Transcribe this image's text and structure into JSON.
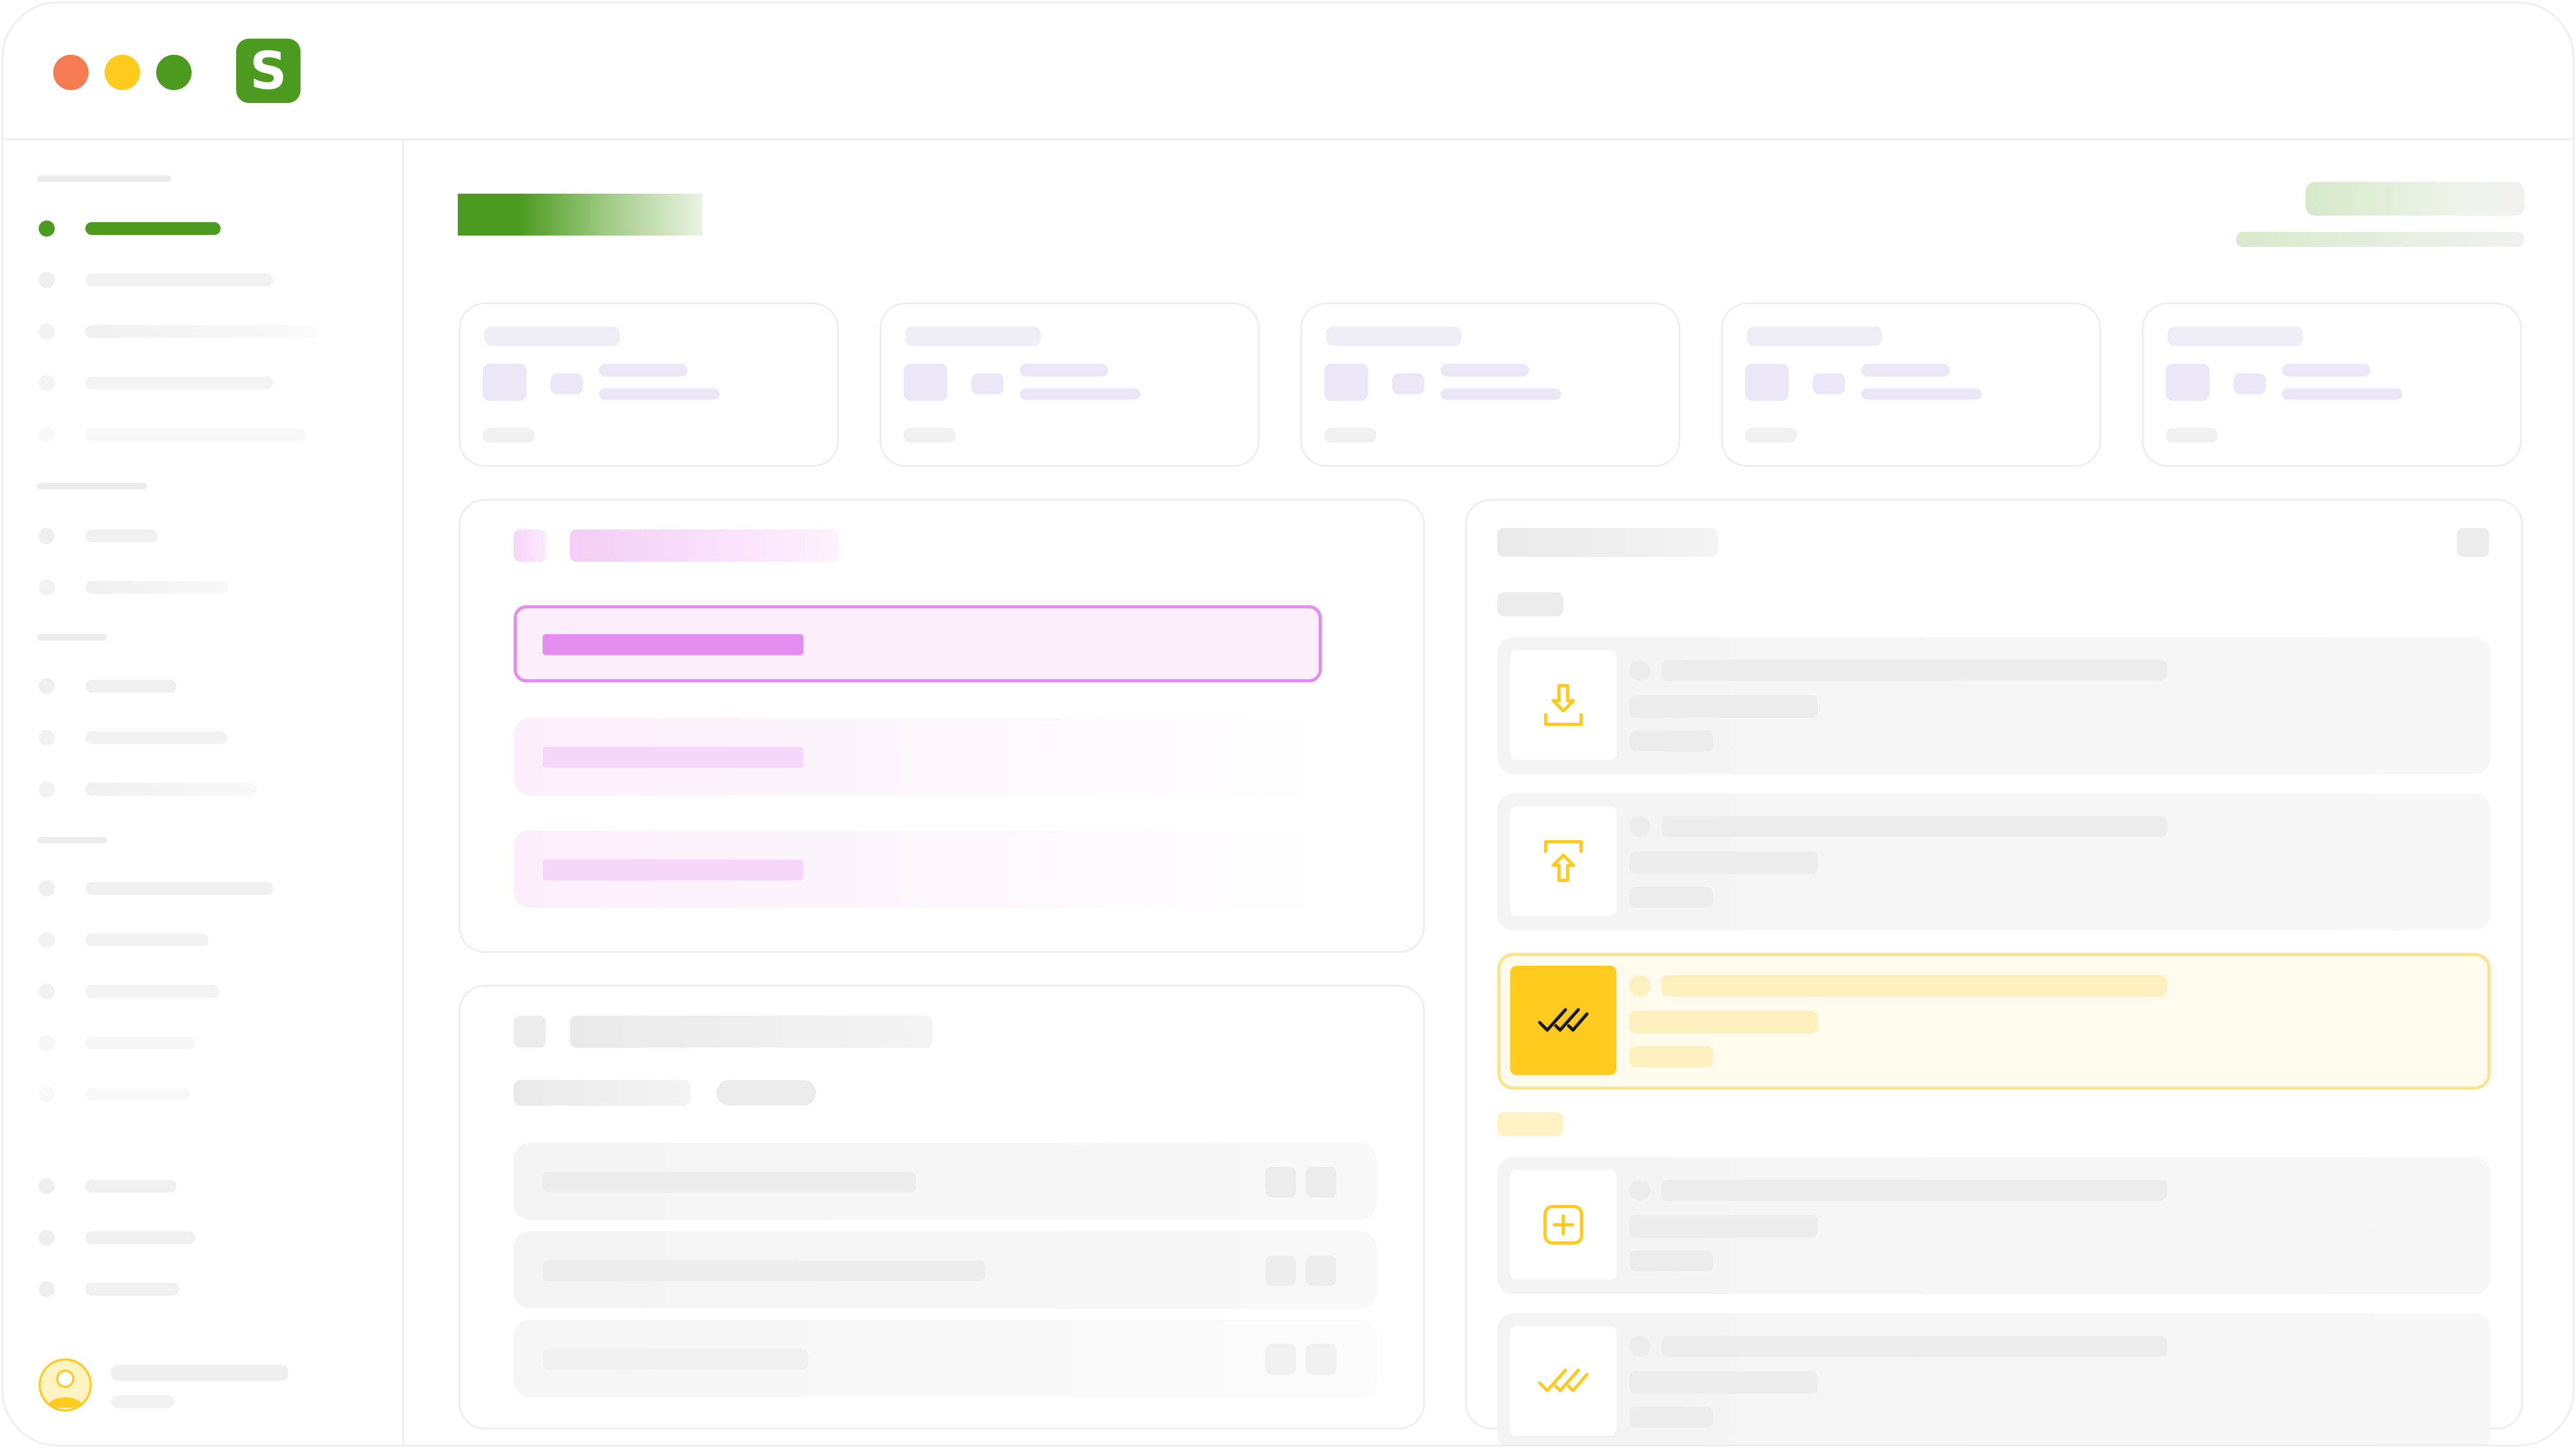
{
  "app": {
    "logo_letter": "S",
    "brand_color": "#4c9a20",
    "window_controls": [
      "close",
      "minimize",
      "maximize"
    ]
  },
  "colors": {
    "accent_green": "#4c9a20",
    "accent_pink": "#e58cf0",
    "accent_yellow": "#ffcb1f",
    "skeleton": "#efefef"
  },
  "activity_icons": [
    "download-icon",
    "upload-icon",
    "double-check-icon",
    "plus-icon",
    "double-check-icon"
  ],
  "selected_activity_index": 2
}
